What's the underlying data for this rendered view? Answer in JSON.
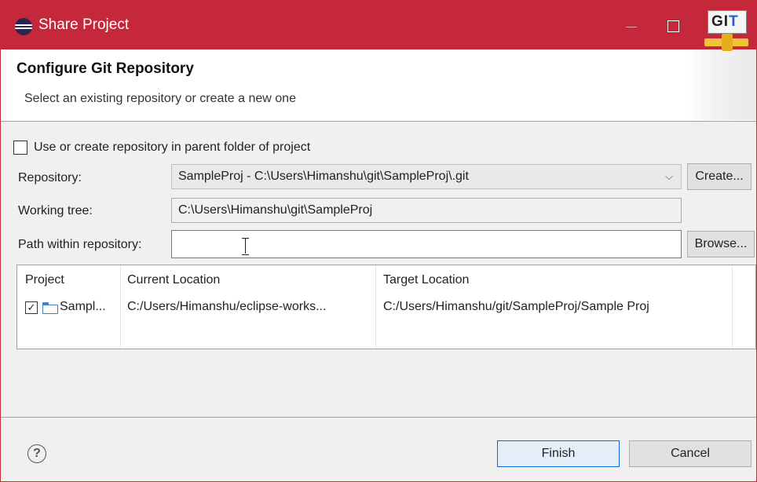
{
  "window": {
    "title": "Share Project",
    "minimize_icon": "minimize-icon",
    "maximize_icon": "maximize-icon",
    "close_glyph": "✕"
  },
  "header": {
    "title": "Configure Git Repository",
    "subtitle": "Select an existing repository or create a new one",
    "logo_text_g": "GI",
    "logo_text_t": "T"
  },
  "form": {
    "use_parent_label": "Use or create repository in parent folder of project",
    "use_parent_checked": false,
    "repository_label": "Repository:",
    "repository_value": "SampleProj - C:\\Users\\Himanshu\\git\\SampleProj\\.git",
    "create_button": "Create...",
    "working_tree_label": "Working tree:",
    "working_tree_value": "C:\\Users\\Himanshu\\git\\SampleProj",
    "path_label": "Path within repository:",
    "path_value": "",
    "browse_button": "Browse..."
  },
  "table": {
    "columns": [
      "Project",
      "Current Location",
      "Target Location"
    ],
    "rows": [
      {
        "checked": true,
        "project": "Sampl...",
        "current_location": "C:/Users/Himanshu/eclipse-works...",
        "target_location": "C:/Users/Himanshu/git/SampleProj/Sample Proj"
      }
    ]
  },
  "footer": {
    "help_glyph": "?",
    "finish_button": "Finish",
    "cancel_button": "Cancel"
  },
  "colors": {
    "titlebar": "#c5283a",
    "accent_border": "#0a6ad6",
    "folder": "#3b7fd6"
  }
}
